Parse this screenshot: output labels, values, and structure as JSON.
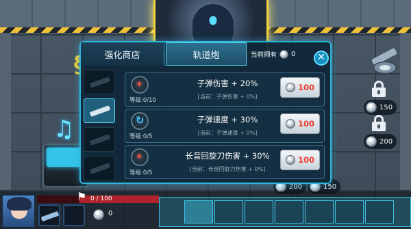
{
  "shop": {
    "tabs": [
      {
        "label": "强化商店"
      },
      {
        "label": "轨道炮"
      }
    ],
    "owned_label": "当前拥有",
    "owned_value": "0",
    "close_icon": "close-icon",
    "upgrades": [
      {
        "level": "等级:0/10",
        "title": "子弹伤害 + 20%",
        "current": "[当前：子弹伤害 + 0%]",
        "price": "100",
        "icon": "bullet-damage-icon"
      },
      {
        "level": "等级:0/5",
        "title": "子弹速度 + 30%",
        "current": "[当前：子弹速度 + 0%]",
        "price": "100",
        "icon": "bullet-speed-icon"
      },
      {
        "level": "等级:0/5",
        "title": "长音回旋刀伤害 + 30%",
        "current": "[当前：长音回旋刀伤害 + 0%]",
        "price": "100",
        "icon": "boomerang-blade-icon"
      }
    ]
  },
  "hud": {
    "hp_text": "0 / 100",
    "hp_fraction": 0.0,
    "coin_value": "0"
  },
  "world": {
    "right_costs": [
      "150",
      "200"
    ],
    "bottom_costs": [
      "200",
      "150"
    ]
  },
  "colors": {
    "accent": "#2fb5d9",
    "price_red": "#ee3d2d",
    "hp_red": "#b0232a"
  }
}
